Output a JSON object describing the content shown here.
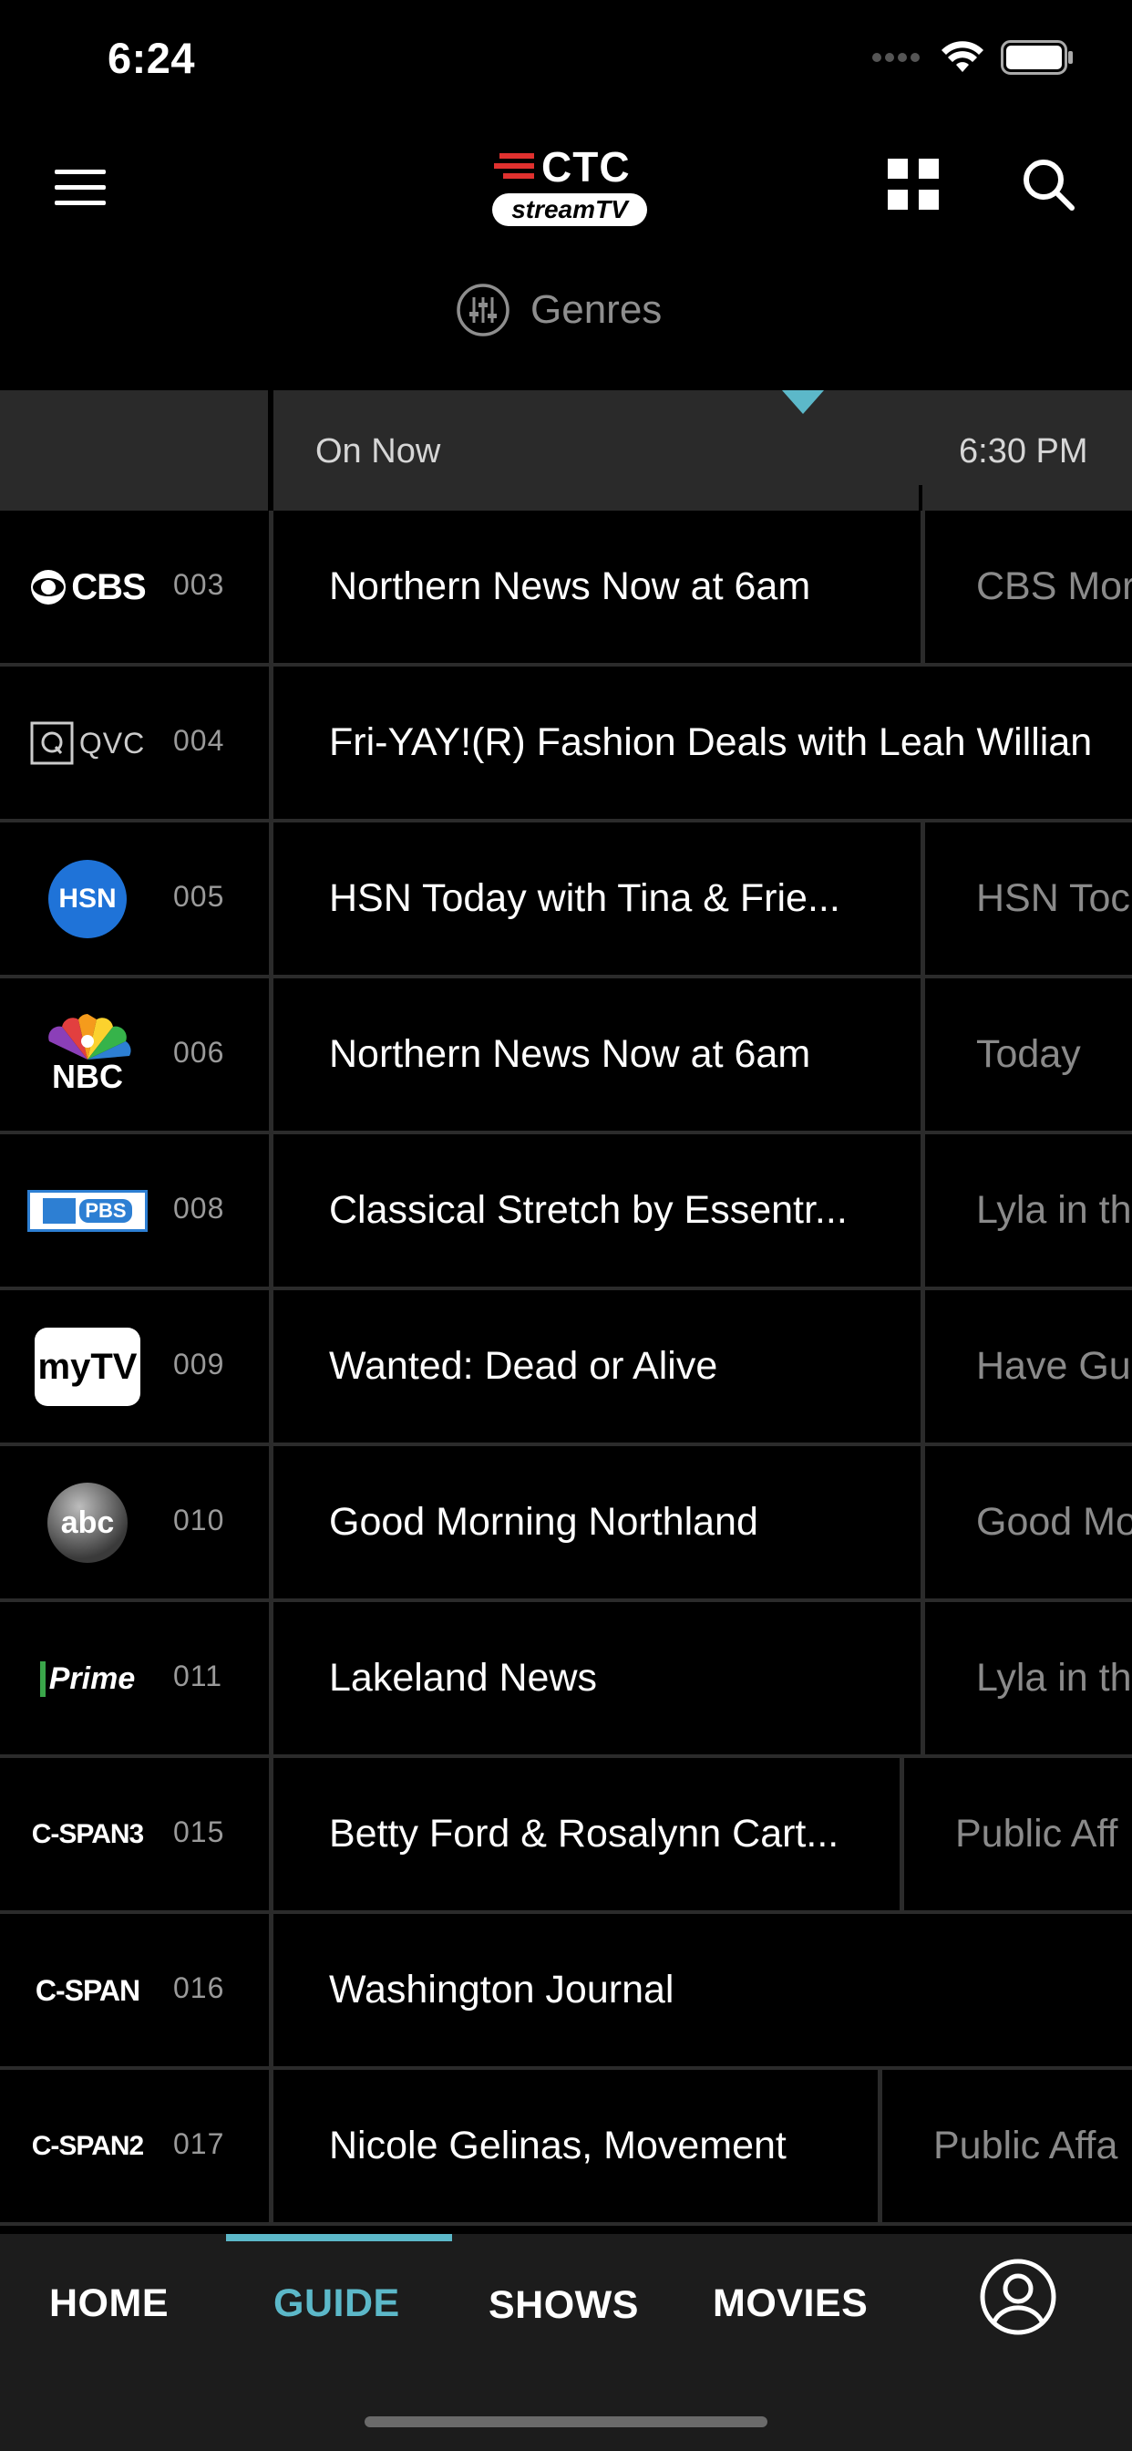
{
  "status_bar": {
    "time": "6:24"
  },
  "header": {
    "logo_top": "CTC",
    "logo_bottom": "streamTV",
    "genres_label": "Genres"
  },
  "guide": {
    "time_now": "On Now",
    "time_next": "6:30 PM",
    "rows": [
      {
        "channel_logo": "CBS",
        "channel_number": "003",
        "now": "Northern News Now at 6am",
        "next": "CBS Mor"
      },
      {
        "channel_logo": "QVC",
        "channel_number": "004",
        "now": "Fri-YAY!(R) Fashion Deals with Leah Willian",
        "next": ""
      },
      {
        "channel_logo": "HSN",
        "channel_number": "005",
        "now": "HSN Today with Tina & Frie...",
        "next": "HSN Toc"
      },
      {
        "channel_logo": "NBC",
        "channel_number": "006",
        "now": "Northern News Now at 6am",
        "next": "Today"
      },
      {
        "channel_logo": "PBS",
        "channel_number": "008",
        "now": "Classical Stretch by Essentr...",
        "next": "Lyla in th"
      },
      {
        "channel_logo": "myTV",
        "channel_number": "009",
        "now": "Wanted: Dead or Alive",
        "next": "Have Gu"
      },
      {
        "channel_logo": "abc",
        "channel_number": "010",
        "now": "Good Morning Northland",
        "next": "Good Mo"
      },
      {
        "channel_logo": "Prime",
        "channel_number": "011",
        "now": "Lakeland News",
        "next": "Lyla in th"
      },
      {
        "channel_logo": "C-SPAN3",
        "channel_number": "015",
        "now": "Betty Ford & Rosalynn Cart...",
        "next": "Public Aff"
      },
      {
        "channel_logo": "C-SPAN",
        "channel_number": "016",
        "now": "Washington Journal",
        "next": ""
      },
      {
        "channel_logo": "C-SPAN2",
        "channel_number": "017",
        "now": "Nicole Gelinas, Movement",
        "next": "Public Affa"
      }
    ]
  },
  "nav": {
    "home": "HOME",
    "guide": "GUIDE",
    "shows": "SHOWS",
    "movies": "MOVIES"
  },
  "colors": {
    "accent": "#5cb8c9",
    "background": "#000000",
    "header_row": "#2a2a2a",
    "nav_background": "#1c1c1c"
  }
}
